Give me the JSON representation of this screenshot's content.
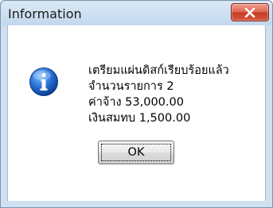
{
  "window": {
    "title": "Information",
    "close_icon": "close-x-icon",
    "accent_close": "#c74a34"
  },
  "message": {
    "icon": "information-icon",
    "lines": [
      "เตรียมแผ่นดิสก์เรียบร้อยแล้ว",
      "จำนวนรายการ 2",
      "ค่าจ้าง 53,000.00",
      "เงินสมทบ 1,500.00"
    ]
  },
  "buttons": {
    "ok_label": "OK"
  }
}
